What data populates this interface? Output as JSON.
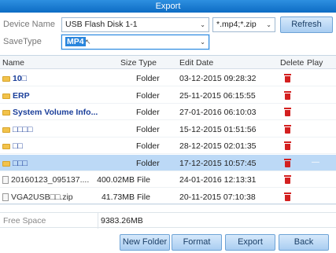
{
  "window": {
    "title": "Export"
  },
  "form": {
    "device_label": "Device Name",
    "device_value": "USB Flash Disk 1-1",
    "filter_value": "*.mp4;*.zip",
    "refresh_label": "Refresh",
    "savetype_label": "SaveType",
    "savetype_value": "MP4"
  },
  "table": {
    "headers": {
      "name": "Name",
      "size_type": "Size Type",
      "edit_date": "Edit Date",
      "delete": "Delete",
      "play": "Play"
    },
    "rows": [
      {
        "name": "10□",
        "size": "",
        "type": "Folder",
        "date": "03-12-2015 09:28:32",
        "kind": "folder"
      },
      {
        "name": "ERP",
        "size": "",
        "type": "Folder",
        "date": "25-11-2015 06:15:55",
        "kind": "folder"
      },
      {
        "name": "System Volume Info...",
        "size": "",
        "type": "Folder",
        "date": "27-01-2016 06:10:03",
        "kind": "folder"
      },
      {
        "name": "□□□□",
        "size": "",
        "type": "Folder",
        "date": "15-12-2015 01:51:56",
        "kind": "folder"
      },
      {
        "name": "□□",
        "size": "",
        "type": "Folder",
        "date": "28-12-2015 02:01:35",
        "kind": "folder"
      },
      {
        "name": "□□□",
        "size": "",
        "type": "Folder",
        "date": "17-12-2015 10:57:45",
        "kind": "folder",
        "selected": true,
        "play": "—"
      },
      {
        "name": "20160123_095137....",
        "size": "400.02MB",
        "type": "File",
        "date": "24-01-2016 12:13:31",
        "kind": "file"
      },
      {
        "name": "VGA2USB□□.zip",
        "size": "41.73MB",
        "type": "File",
        "date": "20-11-2015 07:10:38",
        "kind": "file"
      }
    ]
  },
  "free_space": {
    "label": "Free Space",
    "value": "9383.26MB"
  },
  "buttons": {
    "new_folder": "New Folder",
    "format": "Format",
    "export": "Export",
    "back": "Back"
  }
}
